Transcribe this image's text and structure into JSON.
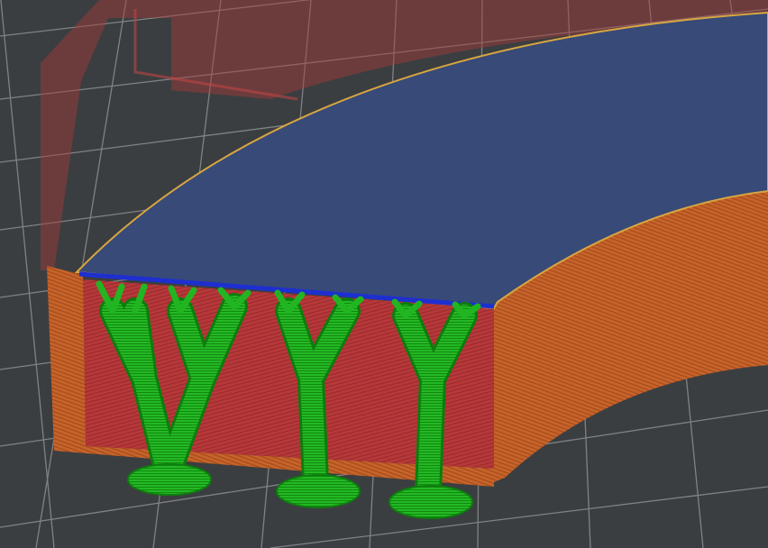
{
  "viewport": {
    "view": "3D preview",
    "colors": {
      "background": "#3b3e40",
      "grid": "#8c8f91",
      "top_surface": "#374a78",
      "top_edge": "#d8a640",
      "perimeter": "#c8642a",
      "internal": "#b8383a",
      "support": "#22b522",
      "support_dark": "#0d7d0d",
      "interface": "#1e2fd0",
      "ghost_object": "#a8393a"
    }
  }
}
